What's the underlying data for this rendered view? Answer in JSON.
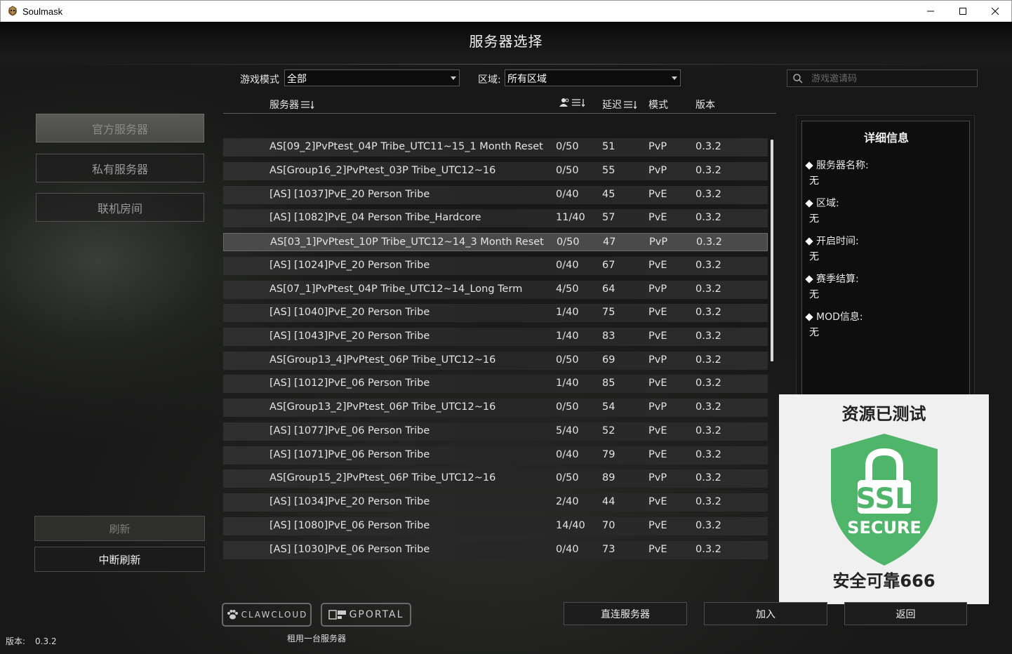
{
  "window": {
    "title": "Soulmask",
    "minimize": "─",
    "maximize": "☐",
    "close": "✕"
  },
  "page_title": "服务器选择",
  "filters": {
    "mode_label": "游戏模式",
    "mode_value": "全部",
    "region_label": "区域:",
    "region_value": "所有区域",
    "invite_placeholder": "游戏邀请码"
  },
  "nav": {
    "official": "官方服务器",
    "private": "私有服务器",
    "lan": "联机房间"
  },
  "actions": {
    "refresh": "刷新",
    "stop_refresh": "中断刷新"
  },
  "table": {
    "headers": {
      "server": "服务器",
      "ping": "延迟",
      "mode": "模式",
      "version": "版本"
    },
    "rows": [
      {
        "name": "AS[09_2]PvPtest_04P Tribe_UTC11~15_1 Month Reset",
        "players": "0/50",
        "ping": "51",
        "mode": "PvP",
        "version": "0.3.2"
      },
      {
        "name": "AS[Group16_2]PvPtest_03P Tribe_UTC12~16",
        "players": "0/50",
        "ping": "55",
        "mode": "PvP",
        "version": "0.3.2"
      },
      {
        "name": "[AS] [1037]PvE_20 Person Tribe",
        "players": "0/40",
        "ping": "45",
        "mode": "PvE",
        "version": "0.3.2"
      },
      {
        "name": "[AS] [1082]PvE_04 Person Tribe_Hardcore",
        "players": "11/40",
        "ping": "57",
        "mode": "PvE",
        "version": "0.3.2"
      },
      {
        "name": "AS[03_1]PvPtest_10P Tribe_UTC12~14_3 Month Reset",
        "players": "0/50",
        "ping": "47",
        "mode": "PvP",
        "version": "0.3.2"
      },
      {
        "name": "[AS] [1024]PvE_20 Person Tribe",
        "players": "0/40",
        "ping": "67",
        "mode": "PvE",
        "version": "0.3.2"
      },
      {
        "name": "AS[07_1]PvPtest_04P Tribe_UTC12~14_Long Term",
        "players": "4/50",
        "ping": "64",
        "mode": "PvP",
        "version": "0.3.2"
      },
      {
        "name": "[AS] [1040]PvE_20 Person Tribe",
        "players": "1/40",
        "ping": "75",
        "mode": "PvE",
        "version": "0.3.2"
      },
      {
        "name": "[AS] [1043]PvE_20 Person Tribe",
        "players": "1/40",
        "ping": "83",
        "mode": "PvE",
        "version": "0.3.2"
      },
      {
        "name": "AS[Group13_4]PvPtest_06P Tribe_UTC12~16",
        "players": "0/50",
        "ping": "69",
        "mode": "PvP",
        "version": "0.3.2"
      },
      {
        "name": "[AS] [1012]PvE_06 Person Tribe",
        "players": "1/40",
        "ping": "85",
        "mode": "PvE",
        "version": "0.3.2"
      },
      {
        "name": "AS[Group13_2]PvPtest_06P Tribe_UTC12~16",
        "players": "0/50",
        "ping": "54",
        "mode": "PvP",
        "version": "0.3.2"
      },
      {
        "name": "[AS] [1077]PvE_06 Person Tribe",
        "players": "5/40",
        "ping": "52",
        "mode": "PvE",
        "version": "0.3.2"
      },
      {
        "name": "[AS] [1071]PvE_06 Person Tribe",
        "players": "0/40",
        "ping": "79",
        "mode": "PvE",
        "version": "0.3.2"
      },
      {
        "name": "AS[Group15_2]PvPtest_06P Tribe_UTC12~16",
        "players": "0/50",
        "ping": "89",
        "mode": "PvP",
        "version": "0.3.2"
      },
      {
        "name": "[AS] [1034]PvE_20 Person Tribe",
        "players": "2/40",
        "ping": "44",
        "mode": "PvE",
        "version": "0.3.2"
      },
      {
        "name": "[AS] [1080]PvE_06 Person Tribe",
        "players": "14/40",
        "ping": "70",
        "mode": "PvE",
        "version": "0.3.2"
      },
      {
        "name": "[AS] [1030]PvE_06 Person Tribe",
        "players": "0/40",
        "ping": "73",
        "mode": "PvE",
        "version": "0.3.2"
      }
    ]
  },
  "details": {
    "title": "详细信息",
    "server_name_label": "服务器名称:",
    "server_name_value": "无",
    "region_label": "区域:",
    "region_value": "无",
    "open_time_label": "开启时间:",
    "open_time_value": "无",
    "season_label": "赛季结算:",
    "season_value": "无",
    "mod_label": "MOD信息:",
    "mod_value": "无"
  },
  "overlay": {
    "top": "资源已测试",
    "ssl": "SSL",
    "secure": "SECURE",
    "bottom": "安全可靠666",
    "shield_color": "#4fb56a"
  },
  "bottom": {
    "clawcloud": "CLAWCLOUD",
    "gportal": "GPORTAL",
    "rent_label": "租用一台服务器",
    "direct_connect": "直连服务器",
    "join": "加入",
    "back": "返回",
    "version_label": "版本:",
    "version_value": "0.3.2"
  }
}
